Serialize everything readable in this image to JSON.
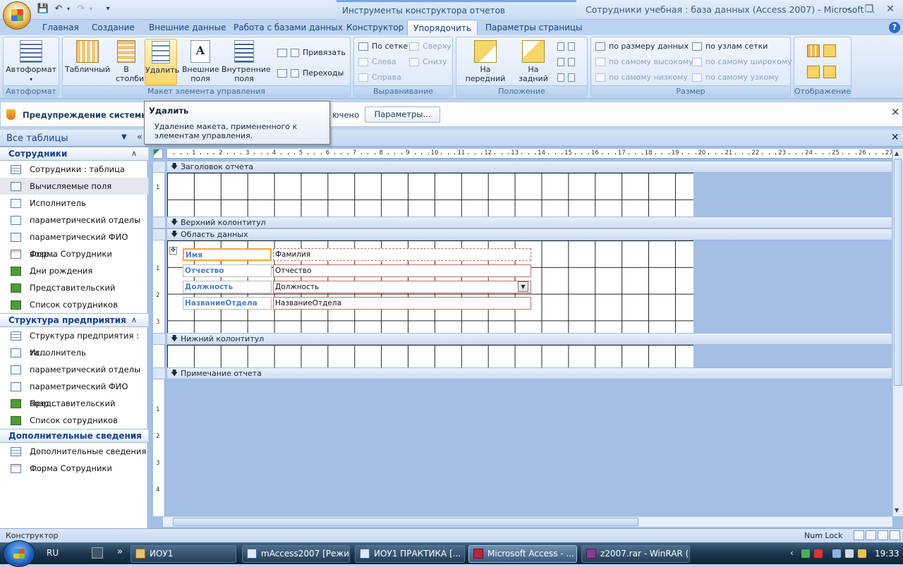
{
  "window": {
    "title": "Сотрудники учебная : база данных (Access 2007) - Microsoft ...",
    "context_tools_title": "Инструменты конструктора отчетов"
  },
  "tabs": [
    {
      "label": "Главная"
    },
    {
      "label": "Создание"
    },
    {
      "label": "Внешние данные"
    },
    {
      "label": "Работа с базами данных"
    },
    {
      "label": "Конструктор"
    },
    {
      "label": "Упорядочить"
    },
    {
      "label": "Параметры страницы"
    }
  ],
  "ribbon": {
    "autoformat": {
      "button": "Автоформат",
      "group": "Автоформат"
    },
    "layout": {
      "tabular": "Табличный",
      "stacked": "В столбик",
      "remove": "Удалить",
      "outer_fields": "Внешние поля",
      "inner_fields": "Внутренние поля",
      "snap": "Привязать",
      "transitions": "Переходы",
      "group": "Макет элемента управления"
    },
    "align": {
      "to_grid": "По сетке",
      "left": "Слева",
      "right": "Справа",
      "top": "Сверху",
      "bottom": "Снизу",
      "group": "Выравнивание"
    },
    "position": {
      "bring_front": "На передний план",
      "send_back": "На задний план",
      "group": "Положение"
    },
    "size": {
      "to_fit": "по размеру данных",
      "to_grid": "по узлам сетки",
      "tallest": "по самому высокому",
      "widest": "по самому широкому",
      "shortest": "по самому низкому",
      "narrowest": "по самому узкому",
      "group": "Размер"
    },
    "display": {
      "group": "Отображение"
    }
  },
  "security_bar": {
    "message": "Предупреждение системы безо",
    "message_tail": "ючено",
    "button": "Параметры..."
  },
  "tooltip": {
    "title": "Удалить",
    "body": "Удаление макета, примененного к элементам управления."
  },
  "nav": {
    "header": "Все таблицы",
    "groups": [
      {
        "title": "Сотрудники",
        "items": [
          {
            "label": "Сотрудники : таблица",
            "icon": "table-icon"
          },
          {
            "label": "Вычисляемые поля",
            "icon": "query-icon"
          },
          {
            "label": "Исполнитель",
            "icon": "query-icon"
          },
          {
            "label": "параметрический отделы",
            "icon": "query-icon"
          },
          {
            "label": "параметрический ФИО возр...",
            "icon": "query-icon"
          },
          {
            "label": "Форма Сотрудники",
            "icon": "form-icon"
          },
          {
            "label": "Дни рождения",
            "icon": "report-icon"
          },
          {
            "label": "Представительский",
            "icon": "report-icon"
          },
          {
            "label": "Список сотрудников",
            "icon": "report-icon"
          }
        ]
      },
      {
        "title": "Структура предприятия",
        "items": [
          {
            "label": "Структура предприятия : та...",
            "icon": "table-icon"
          },
          {
            "label": "Исполнитель",
            "icon": "query-icon"
          },
          {
            "label": "параметрический отделы",
            "icon": "query-icon"
          },
          {
            "label": "параметрический ФИО возр...",
            "icon": "query-icon"
          },
          {
            "label": "Представительский",
            "icon": "report-icon"
          },
          {
            "label": "Список сотрудников",
            "icon": "report-icon"
          }
        ]
      },
      {
        "title": "Дополнительные сведения",
        "items": [
          {
            "label": "Дополнительные сведения :...",
            "icon": "table-icon"
          },
          {
            "label": "Форма Сотрудники",
            "icon": "form-icon"
          }
        ]
      }
    ]
  },
  "report": {
    "sections": {
      "report_header": "Заголовок отчета",
      "page_header": "Верхний колонтитул",
      "detail": "Область данных",
      "page_footer": "Нижний колонтитул",
      "report_footer": "Примечание отчета"
    },
    "labels": [
      "Имя",
      "Отчество",
      "Должность",
      "НазваниеОтдела"
    ],
    "fields": [
      "Фамилия",
      "Отчество",
      "Должность",
      "НазваниеОтдела"
    ],
    "ruler_numbers": [
      "1",
      "2",
      "3",
      "4",
      "5",
      "6",
      "7",
      "8",
      "9",
      "10",
      "11",
      "12",
      "13",
      "14",
      "15",
      "16",
      "17",
      "18",
      "19",
      "20",
      "21",
      "22",
      "23",
      "24",
      "25",
      "26",
      "27"
    ],
    "vruler_header": [
      "1"
    ],
    "vruler_detail": [
      "1",
      "2",
      "3"
    ],
    "vruler_footer": [
      "1",
      "2",
      "3",
      "4"
    ]
  },
  "status": {
    "mode": "Конструктор",
    "numlock": "Num Lock"
  },
  "taskbar": {
    "lang": "RU",
    "items": [
      {
        "label": "ИОУ1"
      },
      {
        "label": "mAccess2007 [Режи..."
      },
      {
        "label": "ИОУ1 ПРАКТИКА [..."
      },
      {
        "label": "Microsoft Access - ..."
      },
      {
        "label": "z2007.rar - WinRAR (..."
      }
    ],
    "clock": "19:33"
  }
}
